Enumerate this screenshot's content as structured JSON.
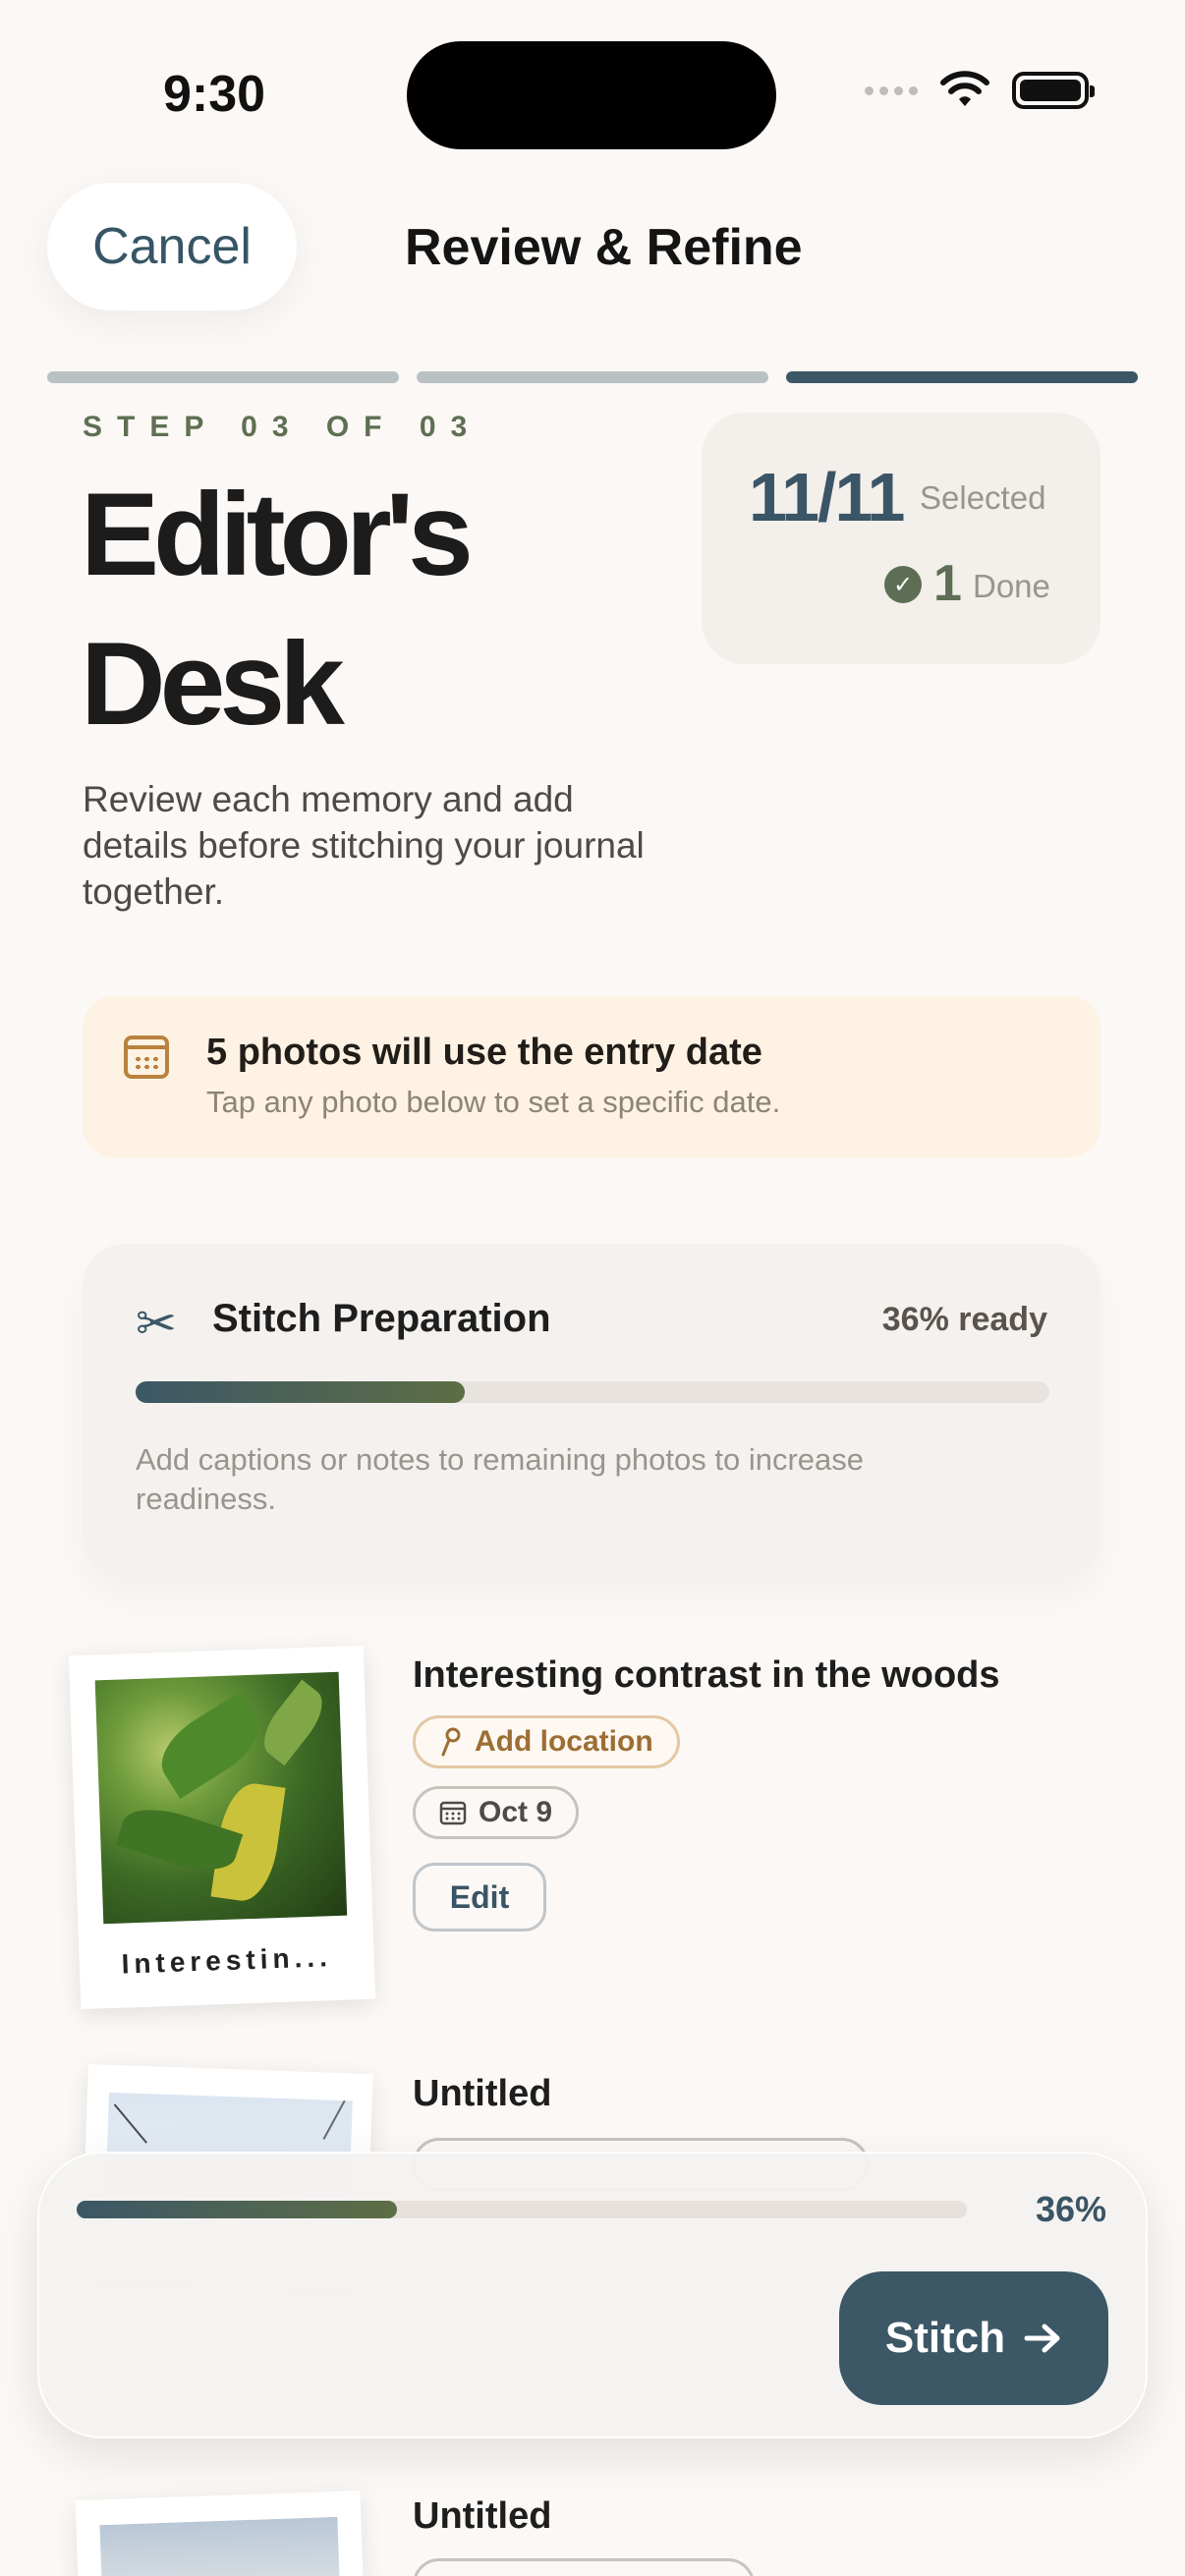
{
  "status_bar": {
    "time": "9:30"
  },
  "nav": {
    "cancel_label": "Cancel",
    "title": "Review & Refine"
  },
  "steps": {
    "total": 3,
    "current": 3
  },
  "header": {
    "step_label": "STEP 03 OF 03",
    "headline": "Editor's Desk",
    "description": "Review each memory and add details before stitching your journal together."
  },
  "stats": {
    "selected_count": "11/11",
    "selected_label": "Selected",
    "done_count": "1",
    "done_label": "Done"
  },
  "notice": {
    "icon": "calendar-icon",
    "title": "5 photos will use the entry date",
    "subtitle": "Tap any photo below to set a specific date."
  },
  "prep": {
    "icon": "scissors-icon",
    "title": "Stitch Preparation",
    "percent_label": "36% ready",
    "progress": 0.36,
    "hint": "Add captions or notes to remaining photos to increase readiness."
  },
  "memories": [
    {
      "title": "Interesting contrast in the woods",
      "caption": "Interestin...",
      "location_label": "Add location",
      "date_label": "Oct 9",
      "edit_label": "Edit"
    },
    {
      "title": "Untitled"
    },
    {
      "title": "Untitled"
    }
  ],
  "footer": {
    "percent_label": "36%",
    "progress": 0.36,
    "stitch_label": "Stitch"
  },
  "colors": {
    "accent": "#3C5766",
    "olive": "#5D6E55",
    "background": "#FBF8F5",
    "notice_bg": "#FDF2E3"
  }
}
